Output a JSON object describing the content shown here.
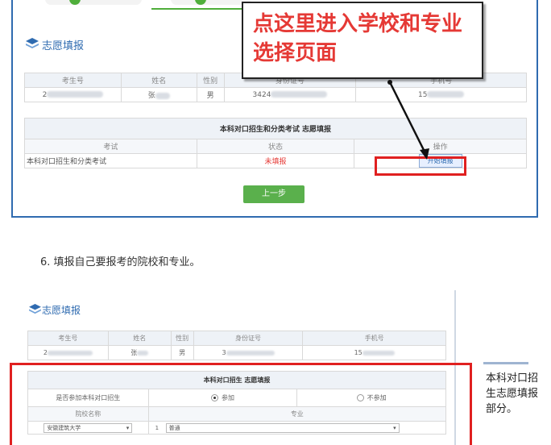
{
  "top": {
    "section_title": "志愿填报",
    "info_headers": [
      "考生号",
      "姓名",
      "性别",
      "身份证号",
      "手机号"
    ],
    "info_values": [
      "2",
      "张",
      "男",
      "3424",
      "15"
    ],
    "exam_caption": "本科对口招生和分类考试 志愿填报",
    "exam_headers": [
      "考试",
      "状态",
      "操作"
    ],
    "exam_row": {
      "exam": "本科对口招生和分类考试",
      "status": "未填报",
      "action": "开始填报"
    },
    "prev_button": "上一步",
    "callout": "点这里进入学校和专业选择页面"
  },
  "step_text": "6. 填报自己要报考的院校和专业。",
  "bottom": {
    "section_title": "志愿填报",
    "info_headers": [
      "考生号",
      "姓名",
      "性别",
      "身份证号",
      "手机号"
    ],
    "info_values": [
      "2",
      "张",
      "男",
      "3",
      "15"
    ],
    "caption": "本科对口招生 志愿填报",
    "participate_question": "是否参加本科对口招生",
    "option_yes": "参加",
    "option_no": "不参加",
    "col_school": "院校名称",
    "col_major": "专业",
    "school_select": "安徽建筑大学",
    "major_select": "普通"
  },
  "side_note": "本科对口招生志愿填报部分。",
  "colors": {
    "accent_blue": "#2f6bb0",
    "alert_red": "#e02020",
    "button_green": "#5ab04c"
  }
}
